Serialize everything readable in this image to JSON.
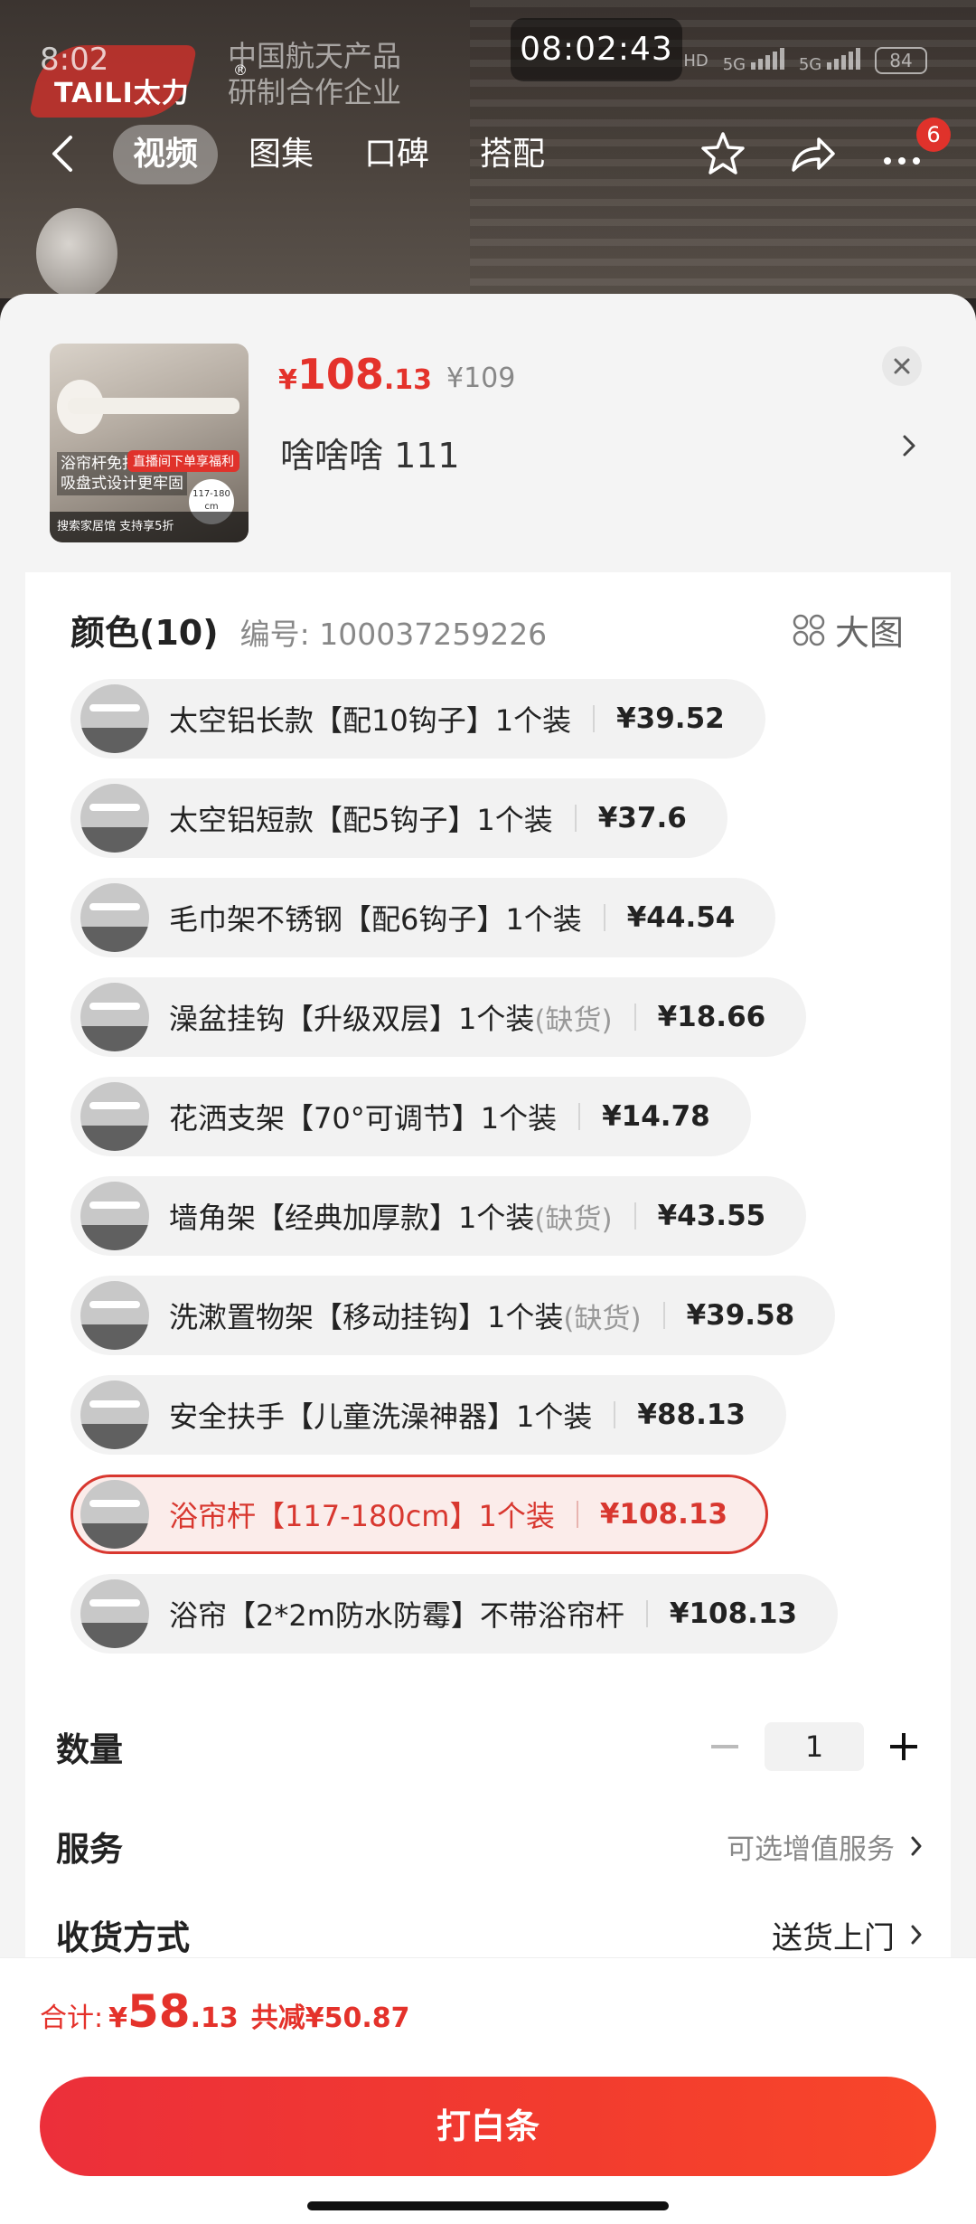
{
  "status_bar": {
    "clock": "8:02",
    "overlay_time": "08:02:43",
    "network": [
      "HD",
      "5G",
      "5G"
    ],
    "battery": "84"
  },
  "hero": {
    "brand": "TAILI太力",
    "aerospace_line1": "中国航天产品",
    "aerospace_line2": "研制合作企业"
  },
  "nav": {
    "tabs": [
      "视频",
      "图集",
      "口碑",
      "搭配"
    ],
    "active_tab": "视频",
    "message_badge": "6"
  },
  "product": {
    "price_symbol": "¥",
    "price_int": "108",
    "price_dec": ".13",
    "original_price": "¥109",
    "selected_text": "啥啥啥  111",
    "thumb_texts": {
      "line1": "浴帘杆免打孔",
      "line2": "吸盘式设计更牢固",
      "tag": "直播间下单享福利",
      "size": "117-180 cm",
      "bottom": "搜索家居馆 支持享5折"
    }
  },
  "color_section": {
    "title": "颜色(10)",
    "sku": "编号: 100037259226",
    "big_view": "大图",
    "options": [
      {
        "label": "太空铝长款【配10钩子】1个装",
        "oos": "",
        "price": "¥39.52",
        "selected": false
      },
      {
        "label": "太空铝短款【配5钩子】1个装",
        "oos": "",
        "price": "¥37.6",
        "selected": false
      },
      {
        "label": "毛巾架不锈钢【配6钩子】1个装",
        "oos": "",
        "price": "¥44.54",
        "selected": false
      },
      {
        "label": "澡盆挂钩【升级双层】1个装",
        "oos": "(缺货)",
        "price": "¥18.66",
        "selected": false
      },
      {
        "label": "花洒支架【70°可调节】1个装",
        "oos": "",
        "price": "¥14.78",
        "selected": false
      },
      {
        "label": "墙角架【经典加厚款】1个装",
        "oos": "(缺货)",
        "price": "¥43.55",
        "selected": false
      },
      {
        "label": "洗漱置物架【移动挂钩】1个装",
        "oos": "(缺货)",
        "price": "¥39.58",
        "selected": false
      },
      {
        "label": "安全扶手【儿童洗澡神器】1个装",
        "oos": "",
        "price": "¥88.13",
        "selected": false
      },
      {
        "label": "浴帘杆【117-180cm】1个装",
        "oos": "",
        "price": "¥108.13",
        "selected": true
      },
      {
        "label": "浴帘【2*2m防水防霉】不带浴帘杆",
        "oos": "",
        "price": "¥108.13",
        "selected": false
      }
    ]
  },
  "quantity": {
    "label": "数量",
    "value": "1"
  },
  "service": {
    "label": "服务",
    "value": "可选增值服务"
  },
  "delivery": {
    "label": "收货方式",
    "value": "送货上门"
  },
  "total": {
    "label": "合计:",
    "symbol": "¥",
    "int": "58",
    "dec": ".13",
    "saved": "共减¥50.87"
  },
  "cta": {
    "label": "打白条"
  },
  "colors": {
    "accent": "#e4322b",
    "selected_bg": "#fbecea"
  }
}
